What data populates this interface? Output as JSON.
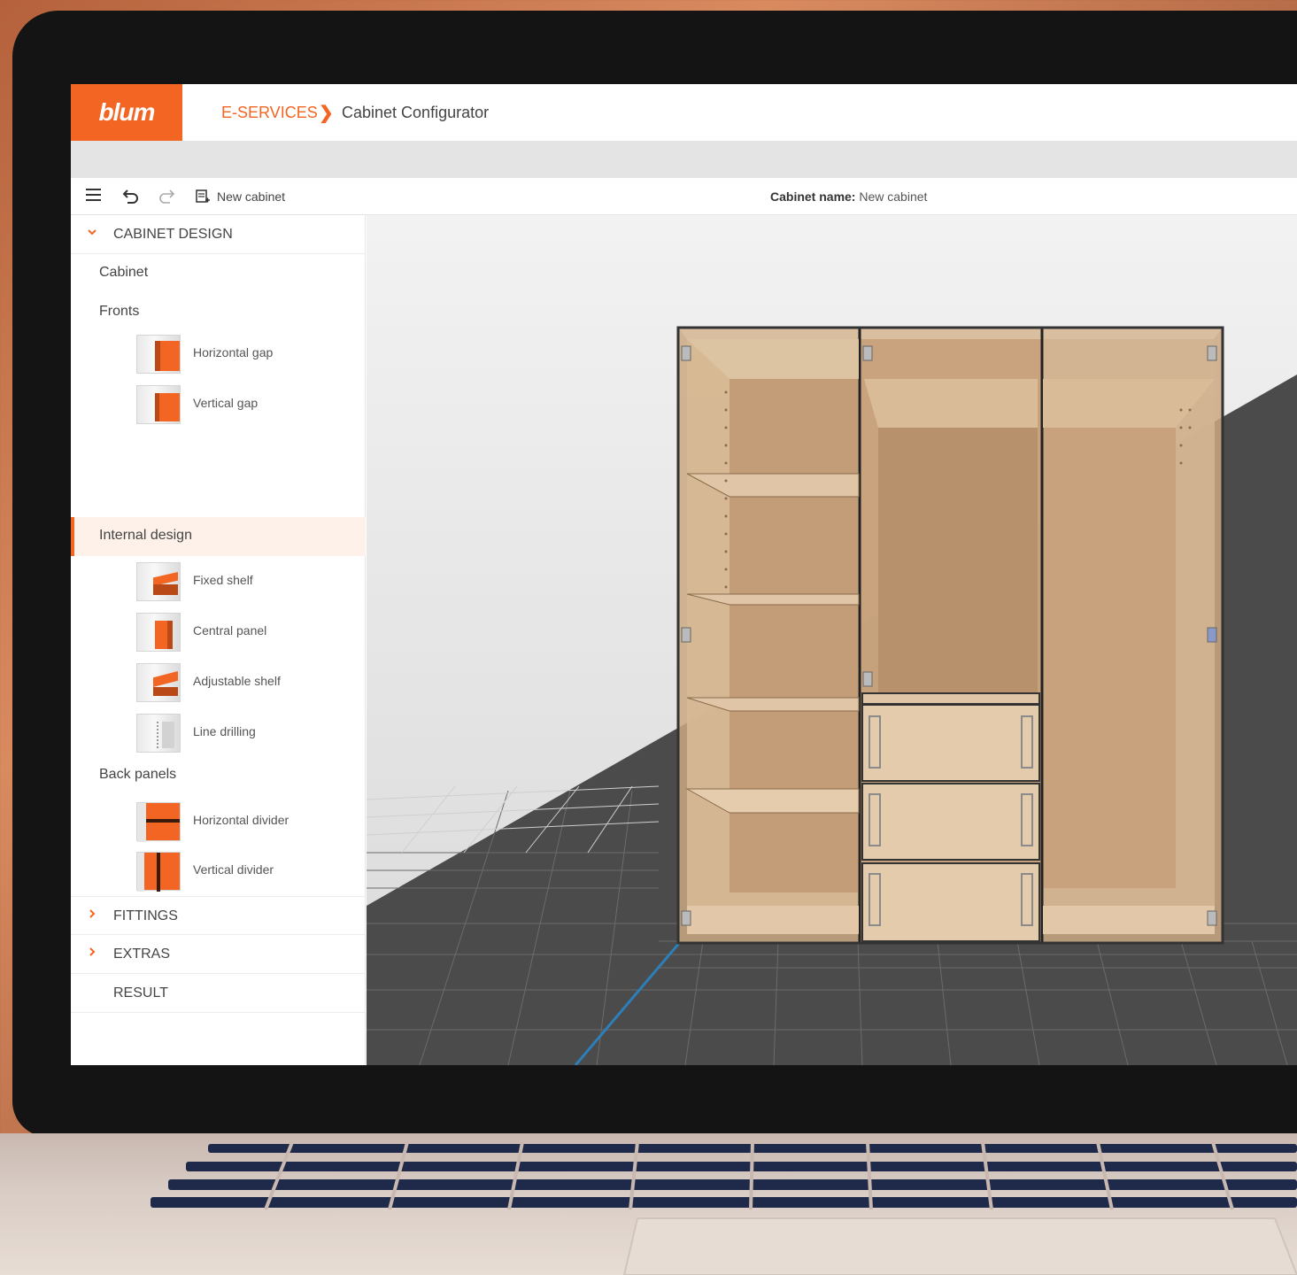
{
  "app": {
    "logo": "blum",
    "breadcrumb": {
      "link": "E-SERVICES",
      "separator": "❯",
      "current": "Cabinet Configurator"
    }
  },
  "toolbar": {
    "menu_icon": "menu-icon",
    "undo_icon": "undo-icon",
    "redo_icon": "redo-icon",
    "new_cabinet_label": "New cabinet",
    "cabinet_name_label": "Cabinet name:",
    "cabinet_name_value": "New cabinet"
  },
  "sidebar": {
    "cabinet_design": {
      "label": "CABINET DESIGN",
      "items": {
        "cabinet": "Cabinet",
        "fronts": "Fronts",
        "fronts_options": [
          "Horizontal gap",
          "Vertical gap"
        ],
        "internal_design": "Internal design",
        "internal_options": [
          "Fixed shelf",
          "Central panel",
          "Adjustable shelf",
          "Line drilling"
        ],
        "back_panels": "Back panels",
        "back_options": [
          "Horizontal divider",
          "Vertical divider"
        ]
      }
    },
    "fittings": "FITTINGS",
    "extras": "EXTRAS",
    "result": "RESULT"
  },
  "colors": {
    "accent": "#f26522",
    "wood": "#d7b995"
  }
}
